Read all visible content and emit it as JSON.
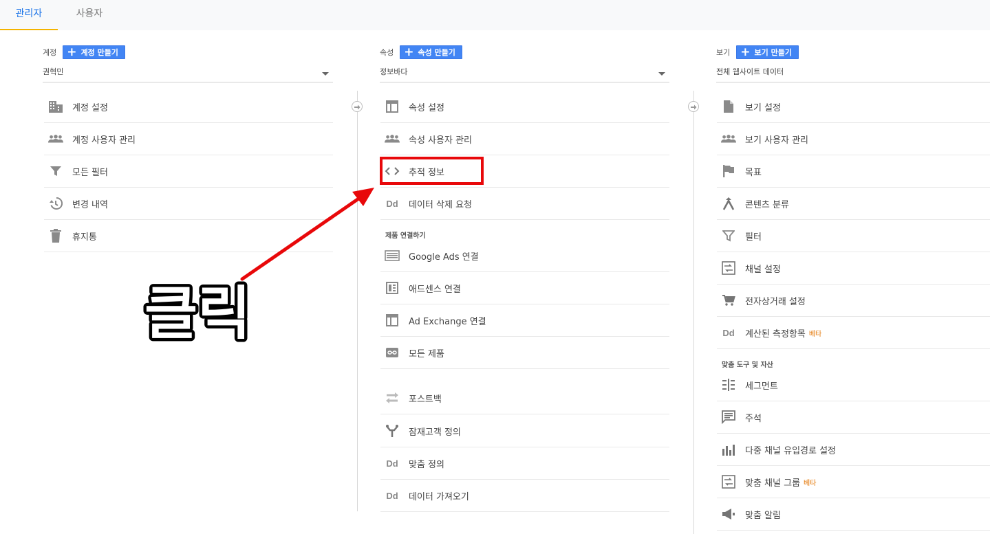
{
  "tabs": {
    "admin": "관리자",
    "user": "사용자"
  },
  "account": {
    "label": "계정",
    "create_button": "계정 만들기",
    "selected": "권혁민",
    "items": [
      {
        "label": "계정 설정",
        "icon": "building-icon"
      },
      {
        "label": "계정 사용자 관리",
        "icon": "people-icon"
      },
      {
        "label": "모든 필터",
        "icon": "filter-icon"
      },
      {
        "label": "변경 내역",
        "icon": "history-icon"
      },
      {
        "label": "휴지통",
        "icon": "trash-icon"
      }
    ]
  },
  "property": {
    "label": "속성",
    "create_button": "속성 만들기",
    "selected": "정보바다",
    "items": [
      {
        "label": "속성 설정",
        "icon": "window-icon"
      },
      {
        "label": "속성 사용자 관리",
        "icon": "people-icon"
      },
      {
        "label": "추적 정보",
        "icon": "code-icon"
      },
      {
        "label": "데이터 삭제 요청",
        "icon": "dd-icon"
      }
    ],
    "section_product": "제품 연결하기",
    "product_items": [
      {
        "label": "Google Ads 연결",
        "icon": "ads-icon"
      },
      {
        "label": "애드센스 연결",
        "icon": "adsense-icon"
      },
      {
        "label": "Ad Exchange 연결",
        "icon": "window-icon"
      },
      {
        "label": "모든 제품",
        "icon": "link-icon"
      }
    ],
    "other_items": [
      {
        "label": "포스트백",
        "icon": "postback-icon"
      },
      {
        "label": "잠재고객 정의",
        "icon": "audience-icon"
      },
      {
        "label": "맞춤 정의",
        "icon": "dd-icon"
      },
      {
        "label": "데이터 가져오기",
        "icon": "dd-icon"
      }
    ]
  },
  "view": {
    "label": "보기",
    "create_button": "보기 만들기",
    "selected": "전체 웹사이트 데이터",
    "items": [
      {
        "label": "보기 설정",
        "icon": "document-icon"
      },
      {
        "label": "보기 사용자 관리",
        "icon": "people-icon"
      },
      {
        "label": "목표",
        "icon": "flag-icon"
      },
      {
        "label": "콘텐츠 분류",
        "icon": "grouping-icon"
      },
      {
        "label": "필터",
        "icon": "filter-icon"
      },
      {
        "label": "채널 설정",
        "icon": "channel-icon"
      },
      {
        "label": "전자상거래 설정",
        "icon": "cart-icon"
      },
      {
        "label": "계산된 측정항목",
        "icon": "dd-icon",
        "badge": "베타"
      }
    ],
    "section_tools": "맞춤 도구 및 자산",
    "tool_items": [
      {
        "label": "세그먼트",
        "icon": "segment-icon"
      },
      {
        "label": "주석",
        "icon": "comment-icon"
      },
      {
        "label": "다중 채널 유입경로 설정",
        "icon": "bars-icon"
      },
      {
        "label": "맞춤 채널 그룹",
        "icon": "channel-icon",
        "badge": "베타"
      },
      {
        "label": "맞춤 알림",
        "icon": "megaphone-icon"
      }
    ]
  },
  "annotation": {
    "text": "클릭",
    "color": "#e8080a"
  },
  "dd_text": "Dd",
  "colors": {
    "accent": "#1a73e8",
    "tab_underline": "#f4b400",
    "button": "#4285f4"
  }
}
